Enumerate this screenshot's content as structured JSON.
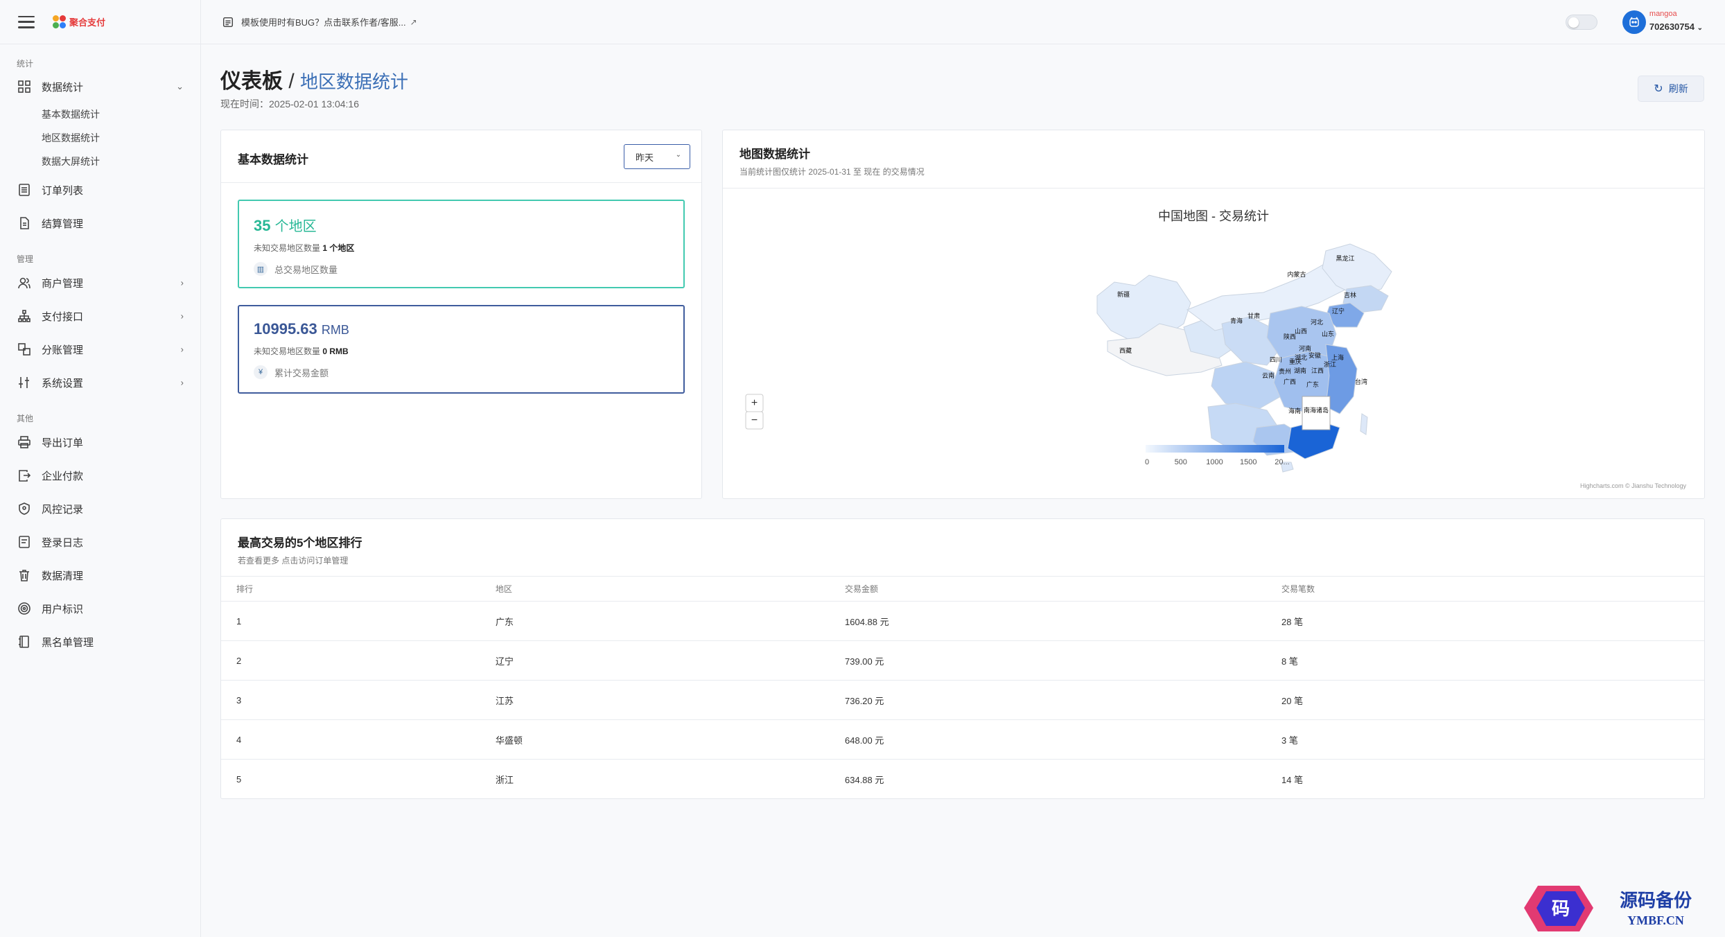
{
  "app": {
    "logo_text": "聚合支付"
  },
  "sidebar": {
    "sections": [
      {
        "title": "统计"
      },
      {
        "title": "管理"
      },
      {
        "title": "其他"
      }
    ],
    "stats_item": "数据统计",
    "stats_subitems": [
      "基本数据统计",
      "地区数据统计",
      "数据大屏统计"
    ],
    "order_list": "订单列表",
    "settlement": "结算管理",
    "merchant": "商户管理",
    "payment_api": "支付接口",
    "split": "分账管理",
    "settings": "系统设置",
    "export_orders": "导出订单",
    "enterprise_pay": "企业付款",
    "risk_records": "风控记录",
    "login_log": "登录日志",
    "data_clean": "数据清理",
    "user_tag": "用户标识",
    "blacklist": "黑名单管理"
  },
  "header": {
    "notice": "模板使用时有BUG？点击联系作者/客服...",
    "user_name": "mangoa",
    "user_id": "702630754"
  },
  "page": {
    "title": "仪表板",
    "separator": "/",
    "subtitle": "地区数据统计",
    "now_time": "现在时间：2025-02-01 13:04:16",
    "refresh_label": "刷新"
  },
  "basic_stats": {
    "title": "基本数据统计",
    "select_value": "昨天",
    "region_count_value": "35",
    "region_count_unit": "个地区",
    "region_unknown_prefix": "未知交易地区数量",
    "region_unknown_value": "1 个地区",
    "region_label": "总交易地区数量",
    "amount_value": "10995.63",
    "amount_unit": "RMB",
    "amount_unknown_prefix": "未知交易地区数量",
    "amount_unknown_value": "0 RMB",
    "amount_label": "累计交易金额"
  },
  "map_stats": {
    "title": "地图数据统计",
    "subtitle": "当前统计图仅统计 2025-01-31 至 现在 的交易情况",
    "chart_title": "中国地图 - 交易统计",
    "zoom_in": "+",
    "zoom_out": "−",
    "south_sea_label": "南海诸岛",
    "legend_ticks": [
      "0",
      "500",
      "1000",
      "1500",
      "20..."
    ],
    "credit": "Highcharts.com © Jianshu Technology",
    "provinces": [
      "黑龙江",
      "吉林",
      "辽宁",
      "内蒙古",
      "新疆",
      "甘肃",
      "青海",
      "河北",
      "山西",
      "山东",
      "陕西",
      "河南",
      "西藏",
      "四川",
      "重庆",
      "湖北",
      "安徽",
      "上海",
      "浙江",
      "贵州",
      "湖南",
      "江西",
      "云南",
      "广西",
      "广东",
      "台湾",
      "海南"
    ],
    "colors": {
      "low": "#eef5fd",
      "high": "#1a64d6"
    }
  },
  "ranking": {
    "title": "最高交易的5个地区排行",
    "subtitle": "若查看更多 点击访问订单管理",
    "headers": [
      "排行",
      "地区",
      "交易金额",
      "交易笔数"
    ],
    "rows": [
      {
        "rank": "1",
        "region": "广东",
        "amount": "1604.88 元",
        "count": "28 笔"
      },
      {
        "rank": "2",
        "region": "辽宁",
        "amount": "739.00 元",
        "count": "8 笔"
      },
      {
        "rank": "3",
        "region": "江苏",
        "amount": "736.20 元",
        "count": "20 笔"
      },
      {
        "rank": "4",
        "region": "华盛顿",
        "amount": "648.00 元",
        "count": "3 笔"
      },
      {
        "rank": "5",
        "region": "浙江",
        "amount": "634.88 元",
        "count": "14 笔"
      }
    ]
  },
  "watermark": {
    "text": "源码备份",
    "domain": "YMBF.CN",
    "glyph": "码"
  }
}
